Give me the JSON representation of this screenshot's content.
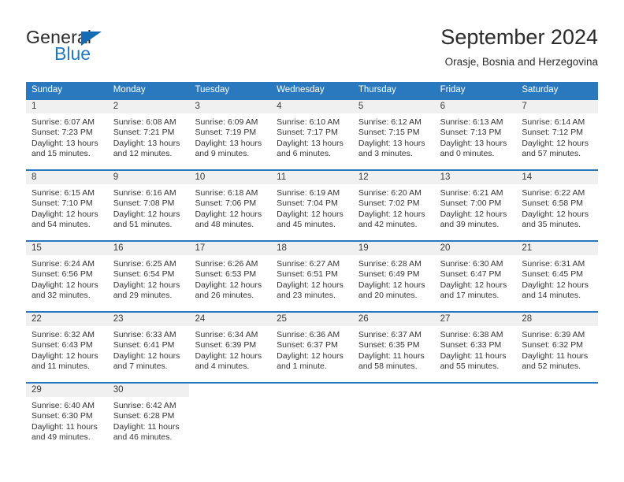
{
  "branding": {
    "logo_text_top": "General",
    "logo_text_bottom": "Blue",
    "logo_triangle": "triangle-icon",
    "brand_dark": "#2b2b2b",
    "brand_blue": "#2279c1"
  },
  "header": {
    "title": "September 2024",
    "location": "Orasje, Bosnia and Herzegovina"
  },
  "theme": {
    "header_row_bg": "#2a78bd",
    "week_divider": "#2a78bd",
    "daynum_band_bg": "#f0f0f0",
    "text": "#353535"
  },
  "calendar": {
    "day_headers": [
      "Sunday",
      "Monday",
      "Tuesday",
      "Wednesday",
      "Thursday",
      "Friday",
      "Saturday"
    ],
    "labels": {
      "sunrise": "Sunrise:",
      "sunset": "Sunset:",
      "daylight": "Daylight:"
    },
    "weeks": [
      [
        {
          "day": "1",
          "sunrise": "Sunrise: 6:07 AM",
          "sunset": "Sunset: 7:23 PM",
          "daylight_1": "Daylight: 13 hours",
          "daylight_2": "and 15 minutes."
        },
        {
          "day": "2",
          "sunrise": "Sunrise: 6:08 AM",
          "sunset": "Sunset: 7:21 PM",
          "daylight_1": "Daylight: 13 hours",
          "daylight_2": "and 12 minutes."
        },
        {
          "day": "3",
          "sunrise": "Sunrise: 6:09 AM",
          "sunset": "Sunset: 7:19 PM",
          "daylight_1": "Daylight: 13 hours",
          "daylight_2": "and 9 minutes."
        },
        {
          "day": "4",
          "sunrise": "Sunrise: 6:10 AM",
          "sunset": "Sunset: 7:17 PM",
          "daylight_1": "Daylight: 13 hours",
          "daylight_2": "and 6 minutes."
        },
        {
          "day": "5",
          "sunrise": "Sunrise: 6:12 AM",
          "sunset": "Sunset: 7:15 PM",
          "daylight_1": "Daylight: 13 hours",
          "daylight_2": "and 3 minutes."
        },
        {
          "day": "6",
          "sunrise": "Sunrise: 6:13 AM",
          "sunset": "Sunset: 7:13 PM",
          "daylight_1": "Daylight: 13 hours",
          "daylight_2": "and 0 minutes."
        },
        {
          "day": "7",
          "sunrise": "Sunrise: 6:14 AM",
          "sunset": "Sunset: 7:12 PM",
          "daylight_1": "Daylight: 12 hours",
          "daylight_2": "and 57 minutes."
        }
      ],
      [
        {
          "day": "8",
          "sunrise": "Sunrise: 6:15 AM",
          "sunset": "Sunset: 7:10 PM",
          "daylight_1": "Daylight: 12 hours",
          "daylight_2": "and 54 minutes."
        },
        {
          "day": "9",
          "sunrise": "Sunrise: 6:16 AM",
          "sunset": "Sunset: 7:08 PM",
          "daylight_1": "Daylight: 12 hours",
          "daylight_2": "and 51 minutes."
        },
        {
          "day": "10",
          "sunrise": "Sunrise: 6:18 AM",
          "sunset": "Sunset: 7:06 PM",
          "daylight_1": "Daylight: 12 hours",
          "daylight_2": "and 48 minutes."
        },
        {
          "day": "11",
          "sunrise": "Sunrise: 6:19 AM",
          "sunset": "Sunset: 7:04 PM",
          "daylight_1": "Daylight: 12 hours",
          "daylight_2": "and 45 minutes."
        },
        {
          "day": "12",
          "sunrise": "Sunrise: 6:20 AM",
          "sunset": "Sunset: 7:02 PM",
          "daylight_1": "Daylight: 12 hours",
          "daylight_2": "and 42 minutes."
        },
        {
          "day": "13",
          "sunrise": "Sunrise: 6:21 AM",
          "sunset": "Sunset: 7:00 PM",
          "daylight_1": "Daylight: 12 hours",
          "daylight_2": "and 39 minutes."
        },
        {
          "day": "14",
          "sunrise": "Sunrise: 6:22 AM",
          "sunset": "Sunset: 6:58 PM",
          "daylight_1": "Daylight: 12 hours",
          "daylight_2": "and 35 minutes."
        }
      ],
      [
        {
          "day": "15",
          "sunrise": "Sunrise: 6:24 AM",
          "sunset": "Sunset: 6:56 PM",
          "daylight_1": "Daylight: 12 hours",
          "daylight_2": "and 32 minutes."
        },
        {
          "day": "16",
          "sunrise": "Sunrise: 6:25 AM",
          "sunset": "Sunset: 6:54 PM",
          "daylight_1": "Daylight: 12 hours",
          "daylight_2": "and 29 minutes."
        },
        {
          "day": "17",
          "sunrise": "Sunrise: 6:26 AM",
          "sunset": "Sunset: 6:53 PM",
          "daylight_1": "Daylight: 12 hours",
          "daylight_2": "and 26 minutes."
        },
        {
          "day": "18",
          "sunrise": "Sunrise: 6:27 AM",
          "sunset": "Sunset: 6:51 PM",
          "daylight_1": "Daylight: 12 hours",
          "daylight_2": "and 23 minutes."
        },
        {
          "day": "19",
          "sunrise": "Sunrise: 6:28 AM",
          "sunset": "Sunset: 6:49 PM",
          "daylight_1": "Daylight: 12 hours",
          "daylight_2": "and 20 minutes."
        },
        {
          "day": "20",
          "sunrise": "Sunrise: 6:30 AM",
          "sunset": "Sunset: 6:47 PM",
          "daylight_1": "Daylight: 12 hours",
          "daylight_2": "and 17 minutes."
        },
        {
          "day": "21",
          "sunrise": "Sunrise: 6:31 AM",
          "sunset": "Sunset: 6:45 PM",
          "daylight_1": "Daylight: 12 hours",
          "daylight_2": "and 14 minutes."
        }
      ],
      [
        {
          "day": "22",
          "sunrise": "Sunrise: 6:32 AM",
          "sunset": "Sunset: 6:43 PM",
          "daylight_1": "Daylight: 12 hours",
          "daylight_2": "and 11 minutes."
        },
        {
          "day": "23",
          "sunrise": "Sunrise: 6:33 AM",
          "sunset": "Sunset: 6:41 PM",
          "daylight_1": "Daylight: 12 hours",
          "daylight_2": "and 7 minutes."
        },
        {
          "day": "24",
          "sunrise": "Sunrise: 6:34 AM",
          "sunset": "Sunset: 6:39 PM",
          "daylight_1": "Daylight: 12 hours",
          "daylight_2": "and 4 minutes."
        },
        {
          "day": "25",
          "sunrise": "Sunrise: 6:36 AM",
          "sunset": "Sunset: 6:37 PM",
          "daylight_1": "Daylight: 12 hours",
          "daylight_2": "and 1 minute."
        },
        {
          "day": "26",
          "sunrise": "Sunrise: 6:37 AM",
          "sunset": "Sunset: 6:35 PM",
          "daylight_1": "Daylight: 11 hours",
          "daylight_2": "and 58 minutes."
        },
        {
          "day": "27",
          "sunrise": "Sunrise: 6:38 AM",
          "sunset": "Sunset: 6:33 PM",
          "daylight_1": "Daylight: 11 hours",
          "daylight_2": "and 55 minutes."
        },
        {
          "day": "28",
          "sunrise": "Sunrise: 6:39 AM",
          "sunset": "Sunset: 6:32 PM",
          "daylight_1": "Daylight: 11 hours",
          "daylight_2": "and 52 minutes."
        }
      ],
      [
        {
          "day": "29",
          "sunrise": "Sunrise: 6:40 AM",
          "sunset": "Sunset: 6:30 PM",
          "daylight_1": "Daylight: 11 hours",
          "daylight_2": "and 49 minutes."
        },
        {
          "day": "30",
          "sunrise": "Sunrise: 6:42 AM",
          "sunset": "Sunset: 6:28 PM",
          "daylight_1": "Daylight: 11 hours",
          "daylight_2": "and 46 minutes."
        },
        {
          "day": "",
          "sunrise": "",
          "sunset": "",
          "daylight_1": "",
          "daylight_2": ""
        },
        {
          "day": "",
          "sunrise": "",
          "sunset": "",
          "daylight_1": "",
          "daylight_2": ""
        },
        {
          "day": "",
          "sunrise": "",
          "sunset": "",
          "daylight_1": "",
          "daylight_2": ""
        },
        {
          "day": "",
          "sunrise": "",
          "sunset": "",
          "daylight_1": "",
          "daylight_2": ""
        },
        {
          "day": "",
          "sunrise": "",
          "sunset": "",
          "daylight_1": "",
          "daylight_2": ""
        }
      ]
    ]
  }
}
